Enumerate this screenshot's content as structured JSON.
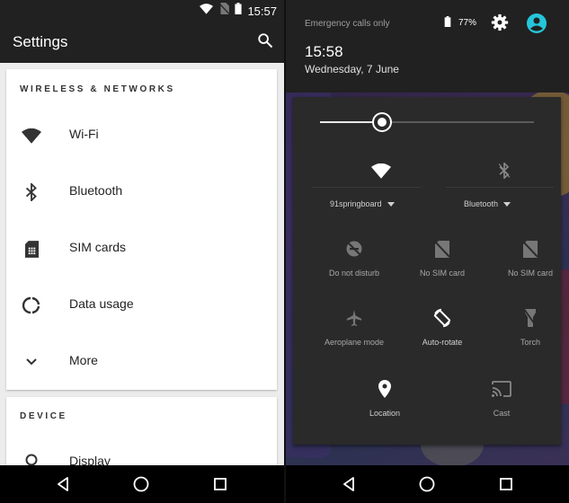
{
  "settings": {
    "status": {
      "time": "15:57"
    },
    "app_title": "Settings",
    "sections": [
      {
        "header": "WIRELESS & NETWORKS",
        "items": [
          {
            "label": "Wi-Fi",
            "icon": "wifi-icon"
          },
          {
            "label": "Bluetooth",
            "icon": "bluetooth-icon"
          },
          {
            "label": "SIM cards",
            "icon": "sim-card-icon"
          },
          {
            "label": "Data usage",
            "icon": "data-usage-icon"
          },
          {
            "label": "More",
            "icon": "chevron-down-icon"
          }
        ]
      },
      {
        "header": "DEVICE",
        "items": [
          {
            "label": "Display",
            "icon": "lightbulb-icon"
          }
        ]
      }
    ]
  },
  "quick_settings": {
    "emergency_text": "Emergency calls only",
    "battery": "77%",
    "time": "15:58",
    "date": "Wednesday, 7 June",
    "brightness": 0.29,
    "wifi_label": "91springboard",
    "bluetooth_label": "Bluetooth",
    "tiles": [
      {
        "label": "Do not disturb",
        "icon": "dnd-off-icon"
      },
      {
        "label": "No SIM card",
        "icon": "no-sim-icon"
      },
      {
        "label": "No SIM card",
        "icon": "no-sim-icon"
      },
      {
        "label": "Aeroplane mode",
        "icon": "airplane-icon"
      },
      {
        "label": "Auto-rotate",
        "icon": "auto-rotate-icon"
      },
      {
        "label": "Torch",
        "icon": "torch-icon"
      },
      {
        "label": "Location",
        "icon": "location-icon"
      },
      {
        "label": "Cast",
        "icon": "cast-icon"
      }
    ]
  },
  "colors": {
    "dark_bar": "#212121",
    "card_bg": "#ffffff",
    "accent_cyan": "#26c6da",
    "panel_bg": "#2a2a2a"
  }
}
